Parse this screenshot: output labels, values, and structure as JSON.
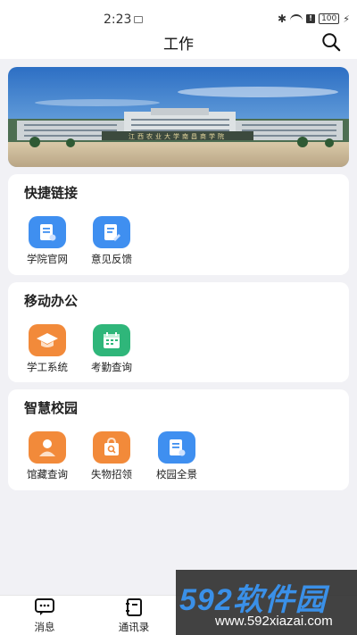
{
  "status_bar": {
    "time": "2:23",
    "battery": "100"
  },
  "header": {
    "title": "工作"
  },
  "banner": {
    "sign_text": "江西农业大学南昌商学院"
  },
  "sections": [
    {
      "title": "快捷链接",
      "items": [
        {
          "label": "学院官网",
          "icon": "document-icon",
          "color": "#3f8ff0"
        },
        {
          "label": "意见反馈",
          "icon": "edit-document-icon",
          "color": "#3f8ff0"
        }
      ]
    },
    {
      "title": "移动办公",
      "items": [
        {
          "label": "学工系统",
          "icon": "graduation-cap-icon",
          "color": "#f28a3a"
        },
        {
          "label": "考勤查询",
          "icon": "calendar-icon",
          "color": "#2fb67a"
        }
      ]
    },
    {
      "title": "智慧校园",
      "items": [
        {
          "label": "馆藏查询",
          "icon": "person-icon",
          "color": "#f28a3a"
        },
        {
          "label": "失物招领",
          "icon": "bag-search-icon",
          "color": "#f28a3a"
        },
        {
          "label": "校园全景",
          "icon": "document-icon",
          "color": "#3f8ff0"
        }
      ]
    }
  ],
  "bottom_nav": [
    {
      "label": "消息",
      "icon": "chat-icon"
    },
    {
      "label": "通讯录",
      "icon": "contacts-icon"
    }
  ],
  "watermark": {
    "logo_text": "592软件园",
    "url": "www.592xiazai.com"
  }
}
